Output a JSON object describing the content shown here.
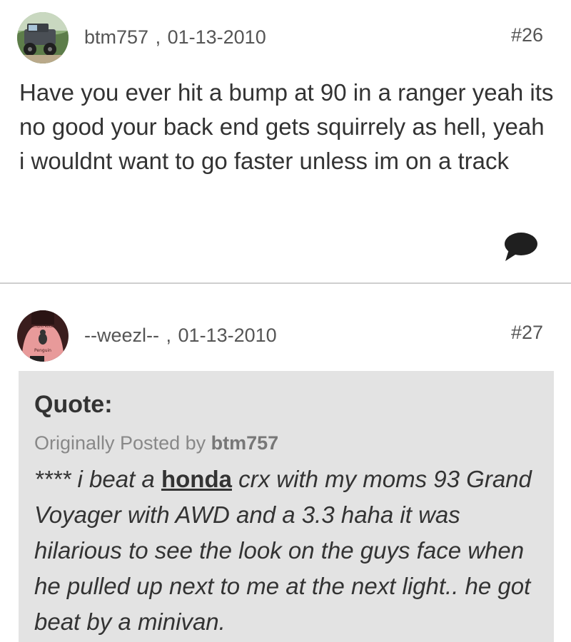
{
  "posts": [
    {
      "username": "btm757",
      "date": "01-13-2010",
      "post_number": "#26",
      "avatar_icon": "truck-avatar",
      "body": "Have you ever hit a bump at 90 in a ranger yeah its no good your back end gets squirrely as hell, yeah i wouldnt want to go faster unless im on a track",
      "action_icon": "comment-bubble-icon"
    },
    {
      "username": "--weezl--",
      "date": "01-13-2010",
      "post_number": "#27",
      "avatar_icon": "penguin-shirt-avatar",
      "quote": {
        "title": "Quote:",
        "originally_posted_by_label": "Originally Posted by",
        "author": "btm757",
        "text_before": "**** i beat a ",
        "keyword": "honda",
        "text_after": " crx with my moms 93 Grand Voyager with AWD and a 3.3 haha it was hilarious to see the look on the guys face when he pulled up next to me at the next light.. he got beat by a minivan."
      }
    }
  ],
  "colors": {
    "text": "#333333",
    "meta": "#555555",
    "quote_bg": "#e3e3e3",
    "divider": "#cfcfcf"
  }
}
